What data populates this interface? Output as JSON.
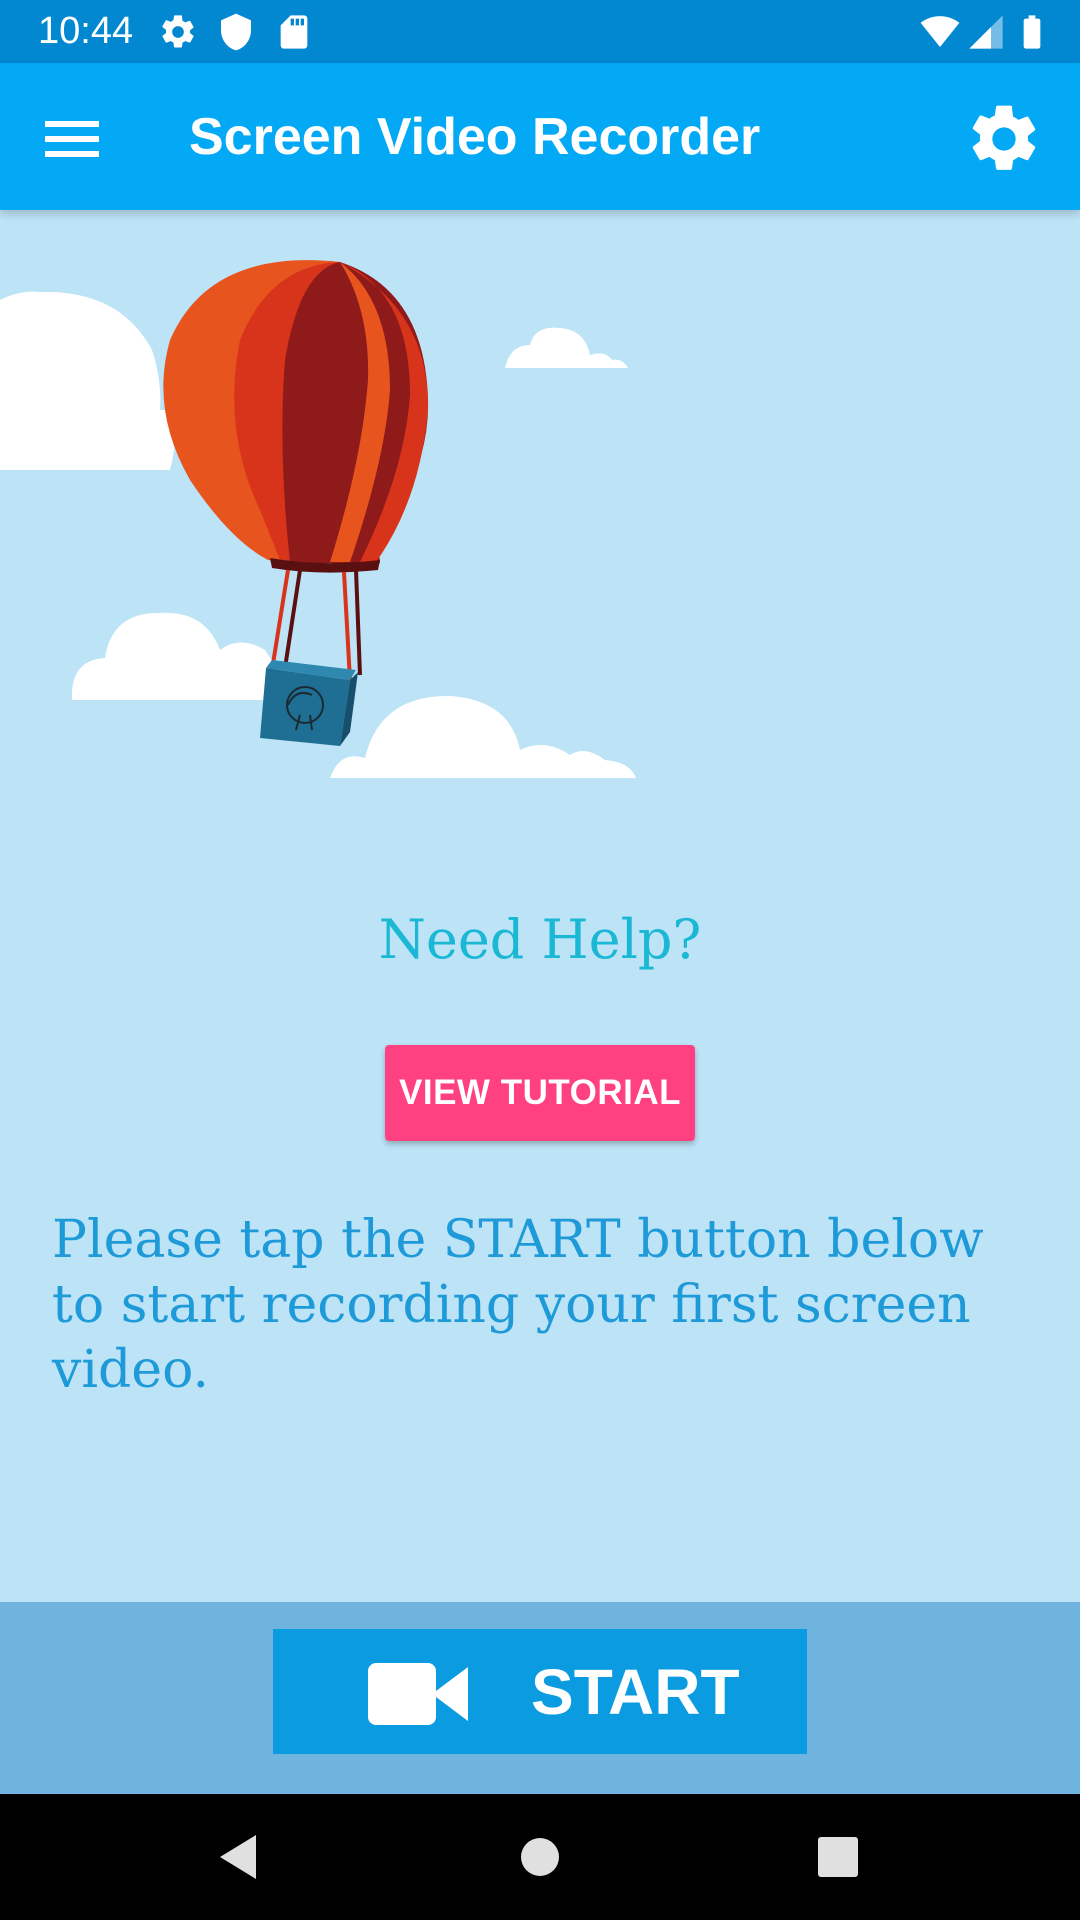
{
  "status_bar": {
    "time": "10:44",
    "icons_left": [
      "gear-icon",
      "shield-icon",
      "sd-card-icon"
    ],
    "icons_right": [
      "wifi-icon",
      "cell-signal-icon",
      "battery-icon"
    ]
  },
  "app_bar": {
    "title": "Screen Video Recorder",
    "menu_icon": "hamburger-menu-icon",
    "settings_icon": "gear-icon"
  },
  "help": {
    "title": "Need Help?",
    "button_label": "VIEW TUTORIAL"
  },
  "instructions": "Please tap the START button below to start recording your first screen video.",
  "start": {
    "label": "START",
    "icon": "videocam-icon"
  },
  "colors": {
    "status_bar": "#0288d1",
    "app_bar": "#03a9f4",
    "background": "#bde3f7",
    "accent_pink": "#ff4081",
    "help_text": "#1ab8d4",
    "body_text": "#1e9ad8",
    "start_panel": "#6fb4df",
    "start_button": "#0b9be0"
  },
  "nav_bar": {
    "icons": [
      "back-icon",
      "home-icon",
      "recents-icon"
    ]
  }
}
